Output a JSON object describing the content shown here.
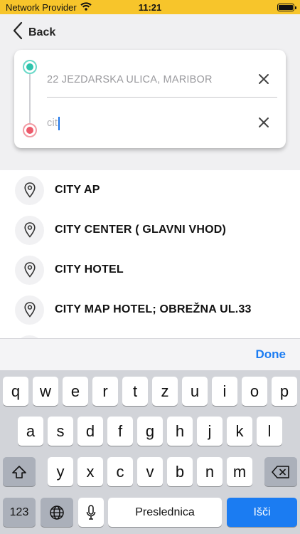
{
  "status_bar": {
    "carrier": "Network Provider",
    "time": "11:21"
  },
  "nav": {
    "back_label": "Back"
  },
  "route": {
    "from_value": "22 JEZDARSKA ULICA, MARIBOR",
    "to_value": "cit"
  },
  "suggestions": [
    {
      "label": "CITY AP"
    },
    {
      "label": "CITY CENTER ( GLAVNI VHOD)"
    },
    {
      "label": "CITY HOTEL"
    },
    {
      "label": "CITY MAP HOTEL; OBREŽNA UL.33"
    }
  ],
  "keyboard": {
    "done_label": "Done",
    "row1": [
      "q",
      "w",
      "e",
      "r",
      "t",
      "z",
      "u",
      "i",
      "o",
      "p"
    ],
    "row2": [
      "a",
      "s",
      "d",
      "f",
      "g",
      "h",
      "j",
      "k",
      "l"
    ],
    "row3": [
      "y",
      "x",
      "c",
      "v",
      "b",
      "n",
      "m"
    ],
    "numbers_label": "123",
    "space_label": "Preslednica",
    "return_label": "Išči"
  },
  "colors": {
    "status_bar_bg": "#f7c52b",
    "start_dot": "#2ec4ad",
    "end_dot": "#ec5a6b",
    "accent": "#1b7cf2"
  }
}
